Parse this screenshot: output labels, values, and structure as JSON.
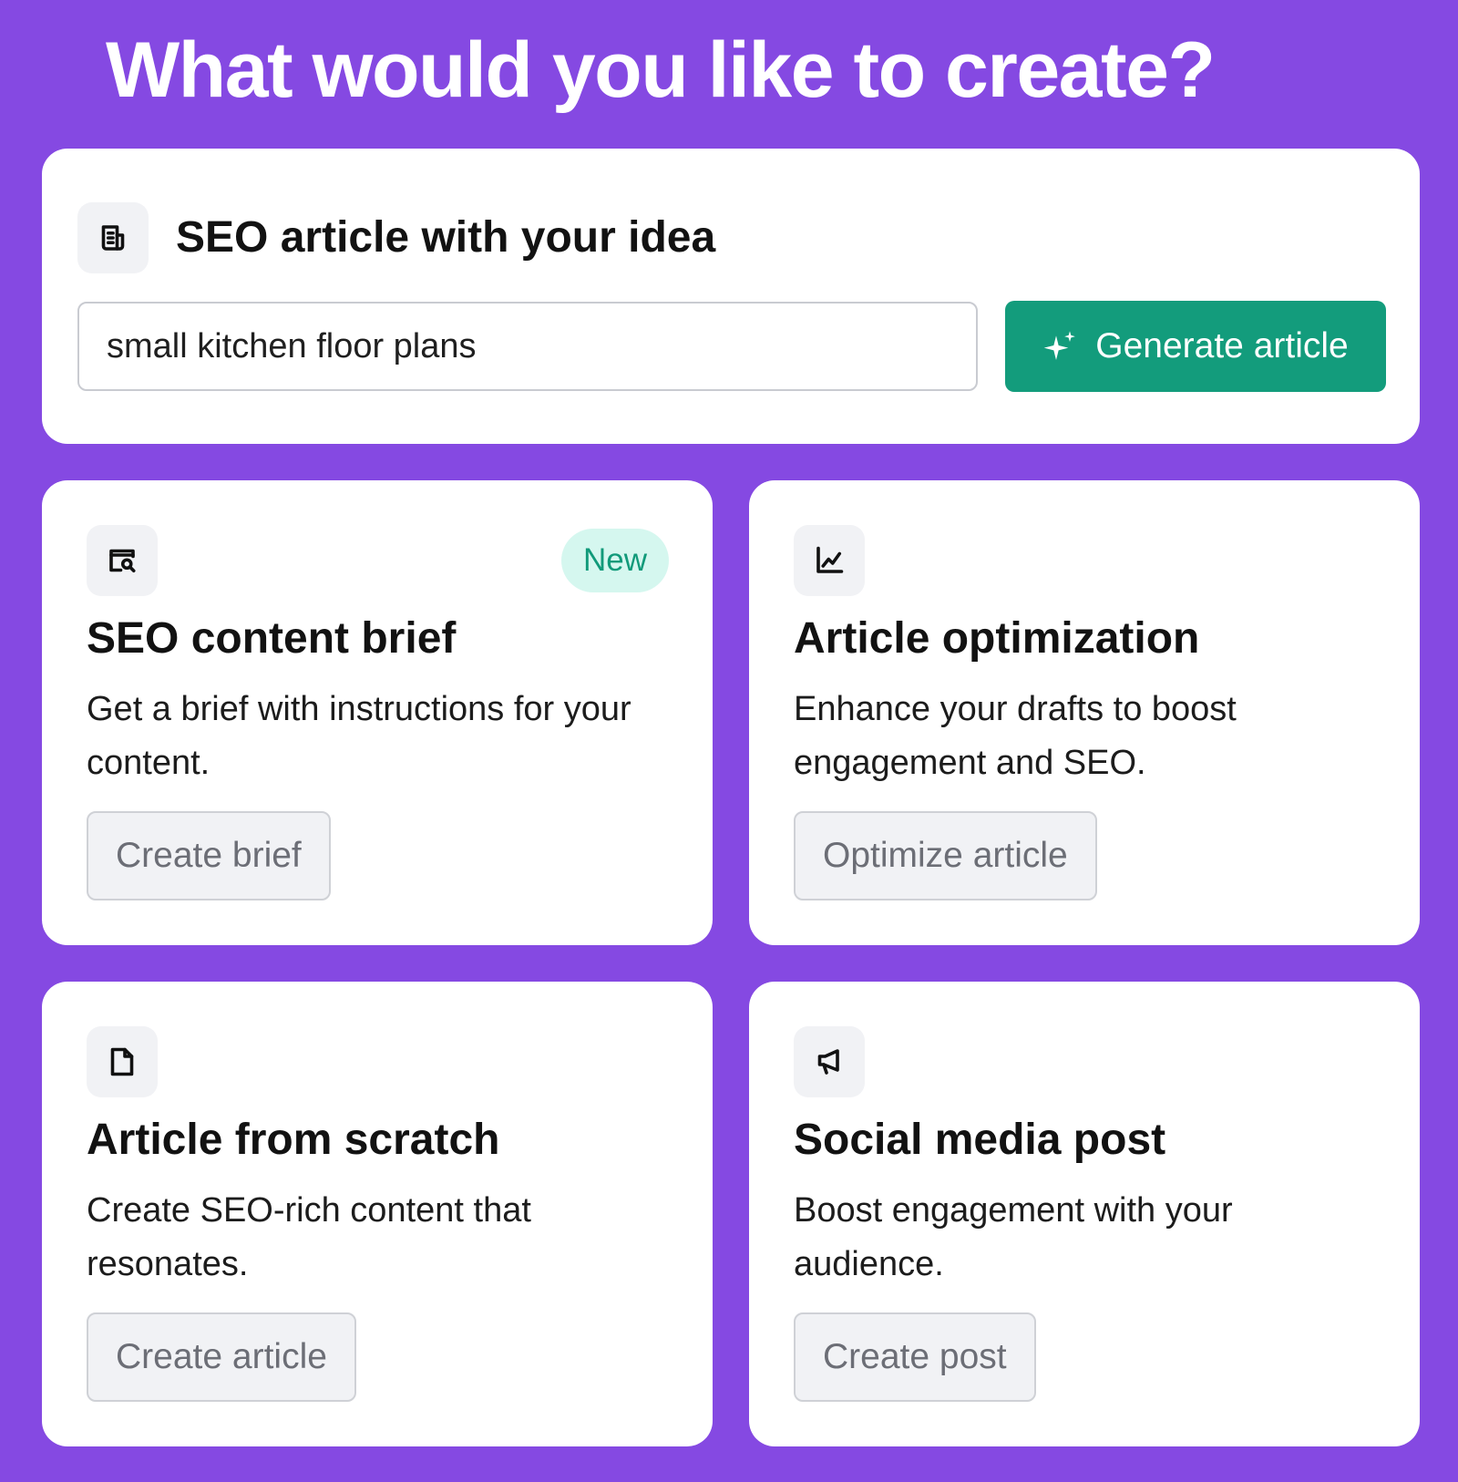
{
  "page": {
    "title": "What would you like to create?"
  },
  "colors": {
    "background": "#8549e2",
    "accent_green": "#139c7c",
    "badge_bg": "#d5f7ef",
    "badge_text": "#119a7a"
  },
  "hero": {
    "icon": "document-lines-icon",
    "title": "SEO article with your idea",
    "input_value": "small kitchen floor plans",
    "button_label": "Generate article",
    "button_icon": "sparkle-icon"
  },
  "cards": [
    {
      "icon": "search-doc-icon",
      "badge": "New",
      "title": "SEO content brief",
      "description": "Get a brief with instructions for your content.",
      "button_label": "Create brief"
    },
    {
      "icon": "line-chart-icon",
      "title": "Article optimization",
      "description": "Enhance your drafts to boost engagement and SEO.",
      "button_label": "Optimize article"
    },
    {
      "icon": "blank-document-icon",
      "title": "Article from scratch",
      "description": "Create SEO-rich content that resonates.",
      "button_label": "Create article"
    },
    {
      "icon": "megaphone-icon",
      "title": "Social media post",
      "description": "Boost engagement with your audience.",
      "button_label": "Create post"
    }
  ]
}
